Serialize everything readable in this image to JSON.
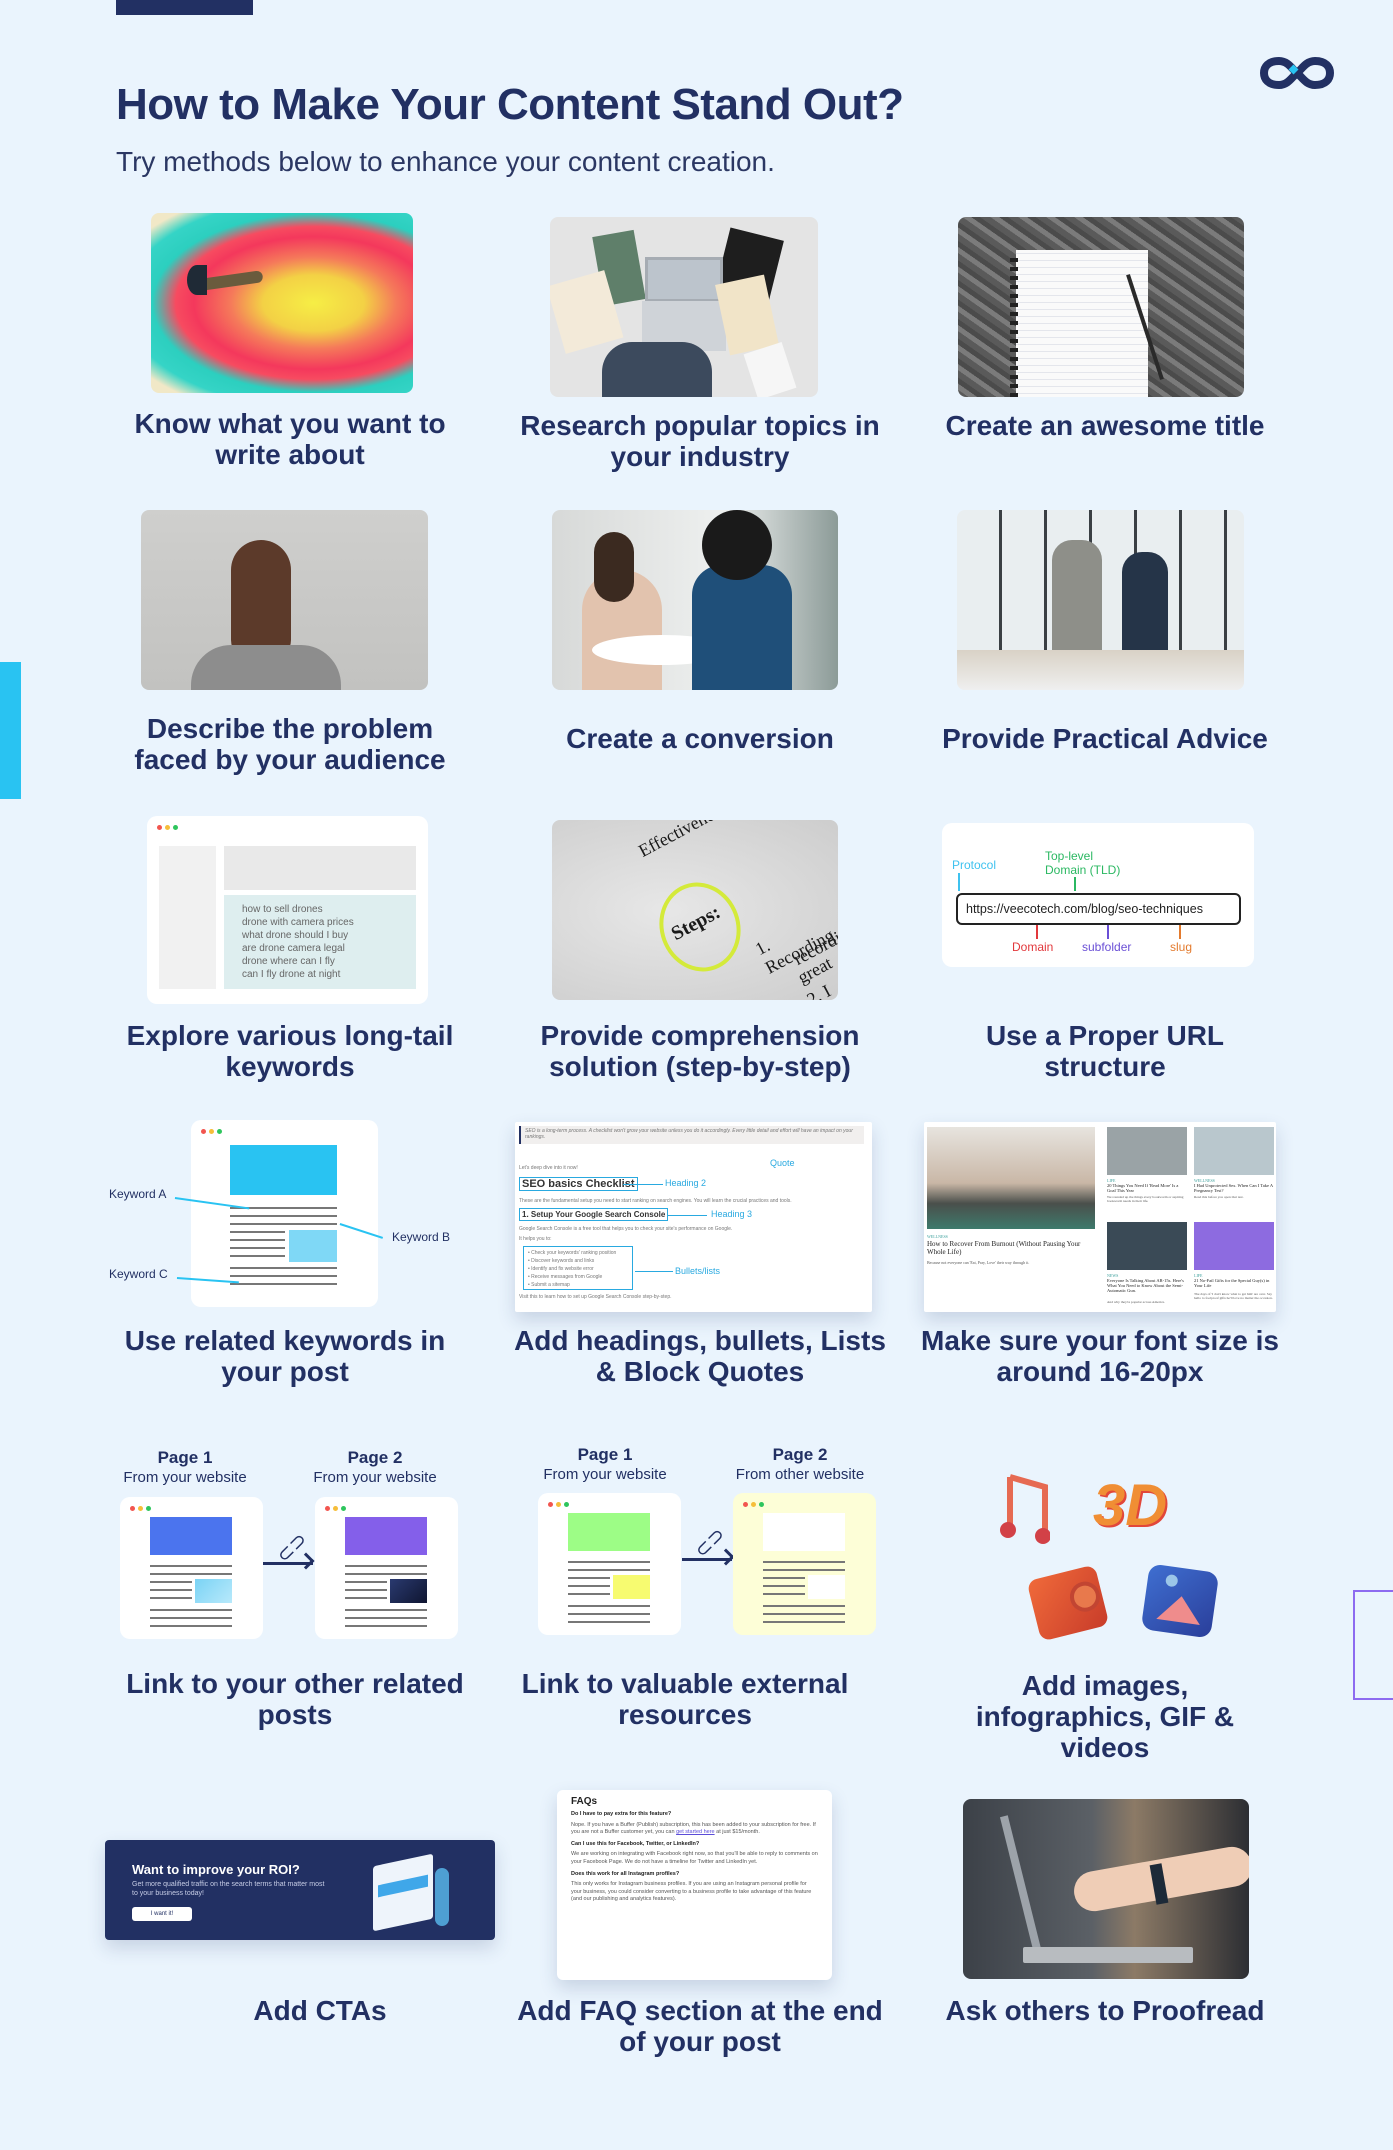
{
  "header": {
    "title": "How to Make Your Content Stand Out?",
    "subtitle": "Try methods below to enhance your content creation.",
    "logo_icon": "infinity-logo-icon"
  },
  "colors": {
    "background": "#eaf4fd",
    "navy": "#223063",
    "cyan_accent": "#29c3f2",
    "purple_accent": "#8d6bf0"
  },
  "tips": [
    {
      "label": "Know what you want to write about",
      "image": "dart-target-photo"
    },
    {
      "label": "Research popular topics in your industry",
      "image": "laptop-books-photo"
    },
    {
      "label": "Create an awesome title",
      "image": "notebook-pen-photo"
    },
    {
      "label": "Describe the problem faced by your audience",
      "image": "thinking-woman-photo"
    },
    {
      "label": "Create a conversion",
      "image": "conversation-photo"
    },
    {
      "label": "Provide Practical Advice",
      "image": "business-men-photo"
    },
    {
      "label": "Explore various long-tail keywords",
      "image": "keyword-list-illustration"
    },
    {
      "label": "Provide comprehension solution (step-by-step)",
      "image": "steps-paper-photo"
    },
    {
      "label": "Use a Proper URL structure",
      "image": "url-structure-illustration"
    },
    {
      "label": "Use related keywords in your post",
      "image": "keyword-page-illustration"
    },
    {
      "label": "Add headings, bullets, Lists & Block Quotes",
      "image": "headings-screenshot"
    },
    {
      "label": "Make sure your font size is around 16-20px",
      "image": "blog-screenshot"
    },
    {
      "label": "Link to your other related posts",
      "image": "internal-link-illustration"
    },
    {
      "label": "Link to valuable external resources",
      "image": "external-link-illustration"
    },
    {
      "label": "Add images, infographics, GIF & videos",
      "image": "3d-media-icons"
    },
    {
      "label": "Add CTAs",
      "image": "cta-banner"
    },
    {
      "label": "Add FAQ section at the end of your post",
      "image": "faq-screenshot"
    },
    {
      "label": "Ask others to Proofread",
      "image": "laptop-pointing-photo"
    }
  ],
  "keyword_list": {
    "items": [
      "how to sell drones",
      "drone with camera prices",
      "what drone should I buy",
      "are drone camera legal",
      "drone where can I fly",
      "can I fly drone at night"
    ]
  },
  "steps_photo": {
    "word1": "Effectiveness is not",
    "word2": "Steps:",
    "item1": "1. Recording",
    "item2": "recordi",
    "item3": "great",
    "item4": "2. I"
  },
  "url_structure": {
    "url": "https://veecotech.com/blog/seo-techniques",
    "protocol": "Protocol",
    "tld": "Top-level Domain (TLD)",
    "domain": "Domain",
    "subfolder": "subfolder",
    "slug": "slug"
  },
  "related_keywords": {
    "a": "Keyword A",
    "b": "Keyword B",
    "c": "Keyword C"
  },
  "headings_demo": {
    "quote_text": "SEO is a long-term process. A checklist won't grow your website unless you do it accordingly. Every little detail and effort will have an impact on your rankings.",
    "intro": "Let's deep dive into it now!",
    "h2": "SEO basics Checklist",
    "h2_label": "Heading 2",
    "para1": "These are the fundamental setup you need to start ranking on search engines. You will learn the crucial practices and tools.",
    "h3": "1. Setup Your Google Search Console",
    "h3_label": "Heading 3",
    "para2": "Google Search Console is a free tool that helps you to check your site's performance on Google.",
    "para3": "It helps you to:",
    "bullets": [
      "Check your keywords' ranking position",
      "Discover keywords and links",
      "Identify and fix website error",
      "Receive messages from Google",
      "Submit a sitemap"
    ],
    "bullets_label": "Bullets/lists",
    "quote_label": "Quote",
    "outro": "Visit this to learn how to set up Google Search Console step-by-step."
  },
  "blog_demo": {
    "main_tag": "WELLNESS",
    "main_title": "How to Recover From Burnout (Without Pausing Your Whole Life)",
    "main_desc": "Because not everyone can 'Eat, Pray, Love' their way through it.",
    "posts": [
      {
        "tag": "LIFE",
        "title": "20 Things You Need If 'Read More' Is a Goal This Year",
        "desc": "We rounded up the things every bookworm or aspiring bookworm needs in their life."
      },
      {
        "tag": "WELLNESS",
        "title": "I Had Unprotected Sex. When Can I Take A Pregnancy Test?",
        "desc": "Read this before you open that test."
      },
      {
        "tag": "NEWS",
        "title": "Everyone Is Talking About AR-15s. Here's What You Need to Know About the Semi-Automatic Gun.",
        "desc": "And why they're popular across America."
      },
      {
        "tag": "LIFE",
        "title": "21 No-Fail Gifts for the Special Guy(s) in Your Life",
        "desc": "The days of 'I don't know what to get him' are over. Say hello to foolproof gifts he'll love no matter the occasion."
      }
    ]
  },
  "internal_link": {
    "page1_title": "Page 1",
    "page1_sub": "From your website",
    "page2_title": "Page 2",
    "page2_sub": "From your website"
  },
  "external_link": {
    "page1_title": "Page 1",
    "page1_sub": "From your website",
    "page2_title": "Page 2",
    "page2_sub": "From other website"
  },
  "cta_banner": {
    "heading": "Want to improve your ROI?",
    "text": "Get more qualified traffic on the search terms that matter most to your business today!",
    "button": "I want it!"
  },
  "faq_demo": {
    "title": "FAQs",
    "items": [
      {
        "q": "Do I have to pay extra for this feature?",
        "a_pre": "Nope. If you have a Buffer (Publish) subscription, this has been added to your subscription for free. If you are not a Buffer customer yet, you can ",
        "a_link": "get started here",
        "a_post": " at just $15/month."
      },
      {
        "q": "Can I use this for Facebook, Twitter, or LinkedIn?",
        "a_pre": "We are working on integrating with Facebook right now, so that you'll be able to reply to comments on your Facebook Page. We do not have a timeline for Twitter and LinkedIn yet.",
        "a_link": "",
        "a_post": ""
      },
      {
        "q": "Does this work for all Instagram profiles?",
        "a_pre": "This only works for Instagram business profiles. If you are using an Instagram personal profile for your business, you could consider converting to a business profile to take advantage of this feature (and our publishing and analytics features).",
        "a_link": "",
        "a_post": ""
      }
    ]
  }
}
